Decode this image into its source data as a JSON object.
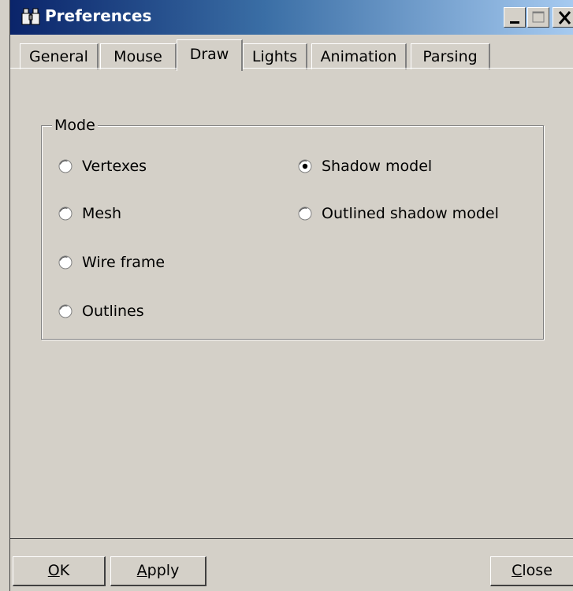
{
  "window": {
    "title": "Preferences",
    "icon": "binoculars-icon"
  },
  "titlebar_buttons": [
    "minimize-icon",
    "maximize-icon",
    "close-icon"
  ],
  "tabs": [
    {
      "label": "General",
      "active": false
    },
    {
      "label": "Mouse",
      "active": false
    },
    {
      "label": "Draw",
      "active": true
    },
    {
      "label": "Lights",
      "active": false
    },
    {
      "label": "Animation",
      "active": false
    },
    {
      "label": "Parsing",
      "active": false
    }
  ],
  "mode_group": {
    "legend": "Mode",
    "options": [
      {
        "label": "Vertexes",
        "checked": false
      },
      {
        "label": "Mesh",
        "checked": false
      },
      {
        "label": "Wire frame",
        "checked": false
      },
      {
        "label": "Outlines",
        "checked": false
      },
      {
        "label": "Shadow model",
        "checked": true
      },
      {
        "label": "Outlined shadow model",
        "checked": false
      }
    ]
  },
  "buttons": {
    "ok": {
      "mnemonic": "O",
      "rest": "K"
    },
    "apply": {
      "mnemonic": "A",
      "rest": "pply"
    },
    "close": {
      "mnemonic": "C",
      "rest": "lose"
    }
  },
  "colors": {
    "face": "#d4d0c8",
    "titlebar_start": "#0a246a",
    "titlebar_end": "#a6caf0"
  }
}
